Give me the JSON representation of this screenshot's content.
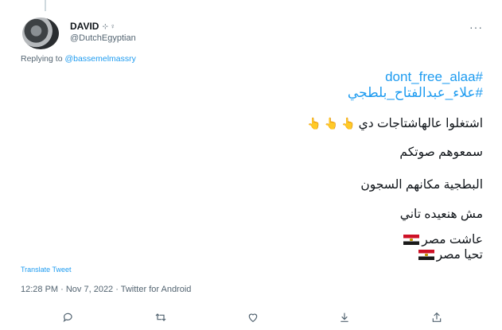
{
  "author": {
    "display_name": "DAVID",
    "name_emoji": "⊹ ♀",
    "handle": "@DutchEgyptian"
  },
  "more_icon": "more-dots-icon",
  "reply": {
    "prefix": "Replying to ",
    "mention": "@bassemelmassry"
  },
  "tweet": {
    "hashtag1": "#dont_free_alaa",
    "hashtag2": "#علاء_عبدالفتاح_بلطجي",
    "line1": "اشتغلوا عالهاشتاجات دي",
    "line1_emoji": "👆",
    "line2": "سمعوهم صوتكم",
    "line3": "البطجية مكانهم السجون",
    "line4": "مش هنعيده تاني",
    "line5": "عاشت مصر",
    "line6": "تحيا مصر"
  },
  "translate_label": "Translate Tweet",
  "meta": "12:28 PM · Nov 7, 2022 · Twitter for Android",
  "actions": [
    "reply-icon",
    "retweet-icon",
    "like-icon",
    "bookmark-icon",
    "share-icon"
  ]
}
